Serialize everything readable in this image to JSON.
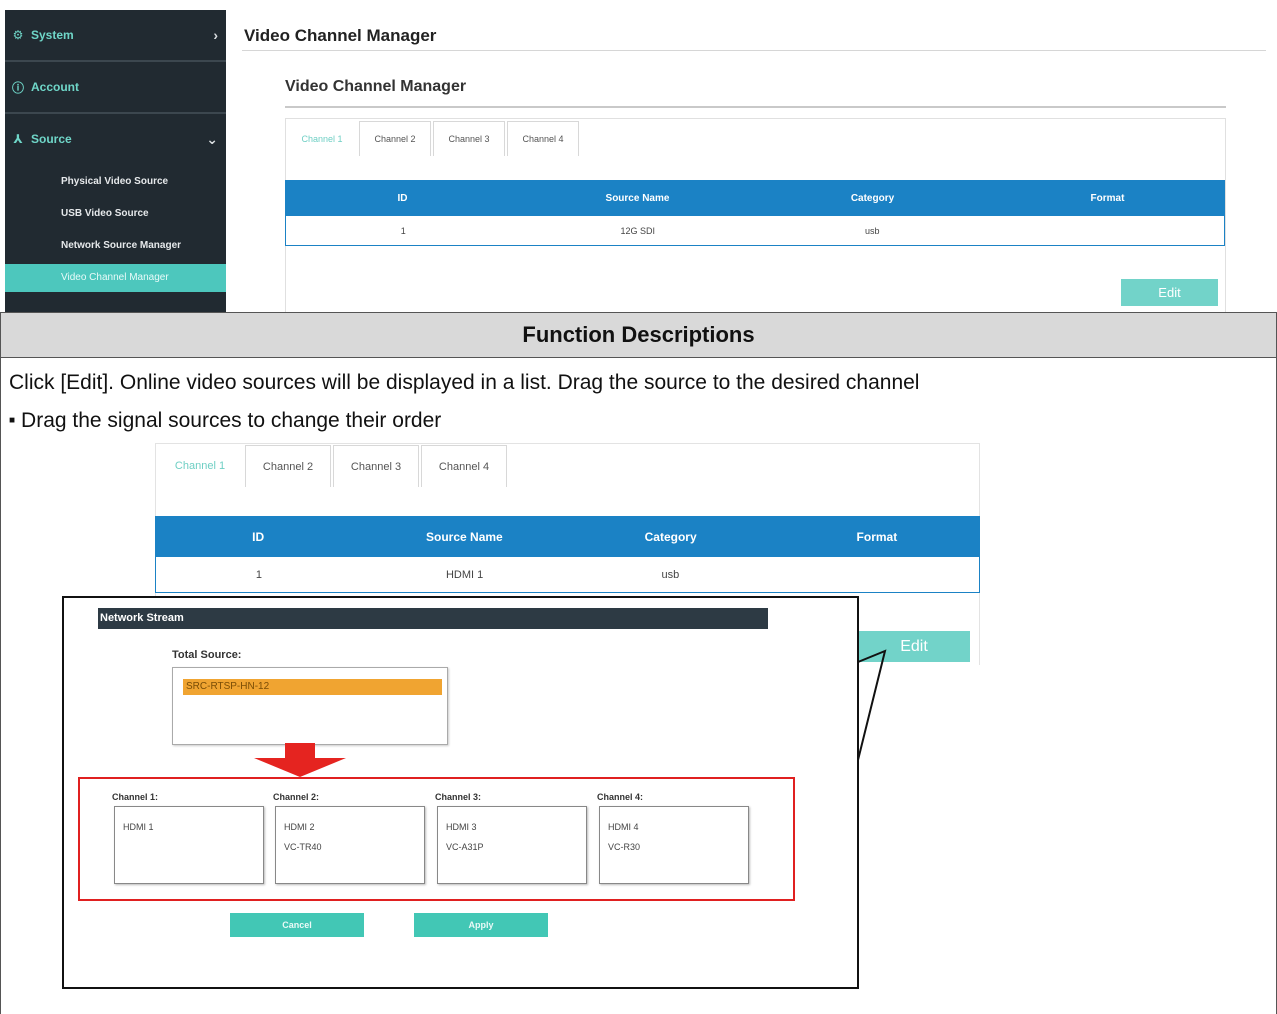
{
  "sidebar": {
    "system_label": "System",
    "account_label": "Account",
    "source_label": "Source",
    "sub_items": [
      "Physical Video Source",
      "USB Video Source",
      "Network Source Manager",
      "Video Channel Manager"
    ]
  },
  "page": {
    "title": "Video Channel Manager",
    "panel_title": "Video Channel Manager"
  },
  "tabs": [
    "Channel 1",
    "Channel 2",
    "Channel 3",
    "Channel 4"
  ],
  "table": {
    "headers": [
      "ID",
      "Source Name",
      "Category",
      "Format"
    ],
    "row_top": [
      "1",
      "12G SDI",
      "usb",
      ""
    ],
    "row_inset": [
      "1",
      "HDMI 1",
      "usb",
      ""
    ]
  },
  "edit_label": "Edit",
  "description": {
    "header": "Function Descriptions",
    "text": "Click [Edit]. Online video sources will be displayed in a list. Drag the source to the desired channel",
    "bullet": "Drag the signal sources to change their order"
  },
  "dialog": {
    "title": "Network Stream",
    "total_label": "Total Source:",
    "total_item": "SRC-RTSP-HN-12",
    "channels": [
      {
        "label": "Channel 1:",
        "sources": [
          "HDMI 1"
        ]
      },
      {
        "label": "Channel 2:",
        "sources": [
          "HDMI 2",
          "VC-TR40"
        ]
      },
      {
        "label": "Channel 3:",
        "sources": [
          "HDMI 3",
          "VC-A31P"
        ]
      },
      {
        "label": "Channel 4:",
        "sources": [
          "HDMI 4",
          "VC-R30"
        ]
      }
    ],
    "cancel_label": "Cancel",
    "apply_label": "Apply"
  },
  "colors": {
    "accent": "#4dc7bd",
    "table_header": "#1b82c5",
    "sidebar_bg": "#212a31",
    "highlight": "#e02020",
    "selected_source": "#f0a431"
  }
}
